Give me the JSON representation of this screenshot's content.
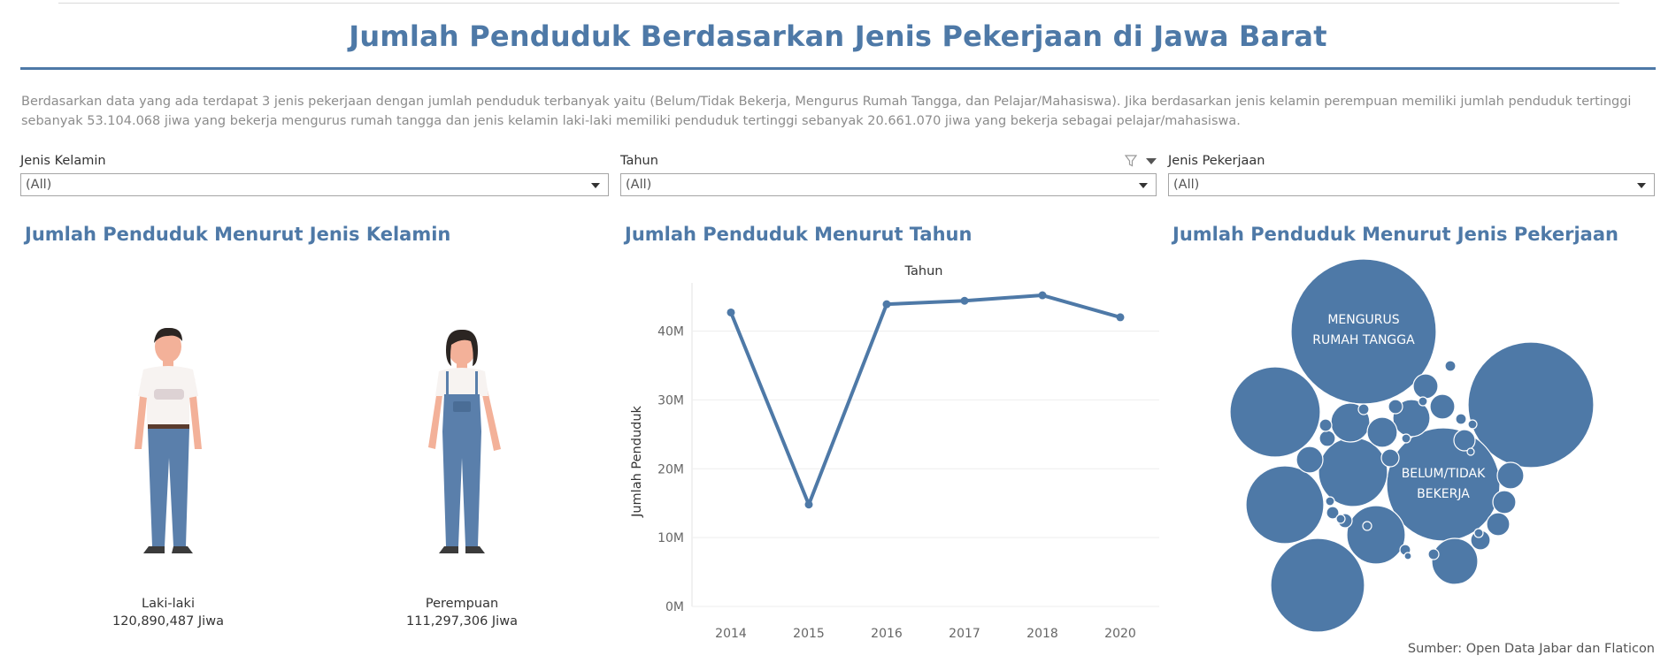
{
  "header": {
    "title": "Jumlah Penduduk Berdasarkan Jenis Pekerjaan di Jawa Barat",
    "description": "Berdasarkan data yang ada terdapat 3 jenis pekerjaan dengan jumlah penduduk terbanyak yaitu (Belum/Tidak Bekerja, Mengurus Rumah Tangga, dan Pelajar/Mahasiswa). Jika berdasarkan jenis kelamin perempuan memiliki jumlah penduduk tertinggi sebanyak 53.104.068 jiwa yang bekerja mengurus rumah tangga dan jenis kelamin laki-laki memiliki penduduk tertinggi sebanyak 20.661.070 jiwa yang bekerja sebagai pelajar/mahasiswa."
  },
  "filters": [
    {
      "label": "Jenis Kelamin",
      "value": "(All)"
    },
    {
      "label": "Tahun",
      "value": "(All)"
    },
    {
      "label": "Jenis Pekerjaan",
      "value": "(All)"
    }
  ],
  "gender_panel": {
    "title": "Jumlah Penduduk Menurut Jenis Kelamin",
    "male": {
      "label": "Laki-laki",
      "value": "120,890,487 Jiwa"
    },
    "female": {
      "label": "Perempuan",
      "value": "111,297,306 Jiwa"
    }
  },
  "year_panel": {
    "title": "Jumlah Penduduk Menurut Tahun"
  },
  "job_panel": {
    "title": "Jumlah Penduduk Menurut Jenis Pekerjaan"
  },
  "source": "Sumber: Open Data Jabar dan Flaticon",
  "colors": {
    "accent": "#4e79a7",
    "text_muted": "#8c8c8c"
  },
  "chart_data": [
    {
      "type": "line",
      "title": "Tahun",
      "xlabel": "",
      "ylabel": "Jumlah Penduduk",
      "categories": [
        "2014",
        "2015",
        "2016",
        "2017",
        "2018",
        "2020"
      ],
      "values": [
        42700000,
        14800000,
        43900000,
        44400000,
        45200000,
        42000000
      ],
      "y_ticks": [
        "0M",
        "10M",
        "20M",
        "30M",
        "40M"
      ],
      "ylim": [
        0,
        47000000
      ],
      "grid": true
    },
    {
      "type": "bubble",
      "labeled": [
        {
          "label_lines": [
            "MENGURUS",
            "RUMAH TANGGA"
          ]
        },
        {
          "label_lines": [
            "BELUM/TIDAK",
            "BEKERJA"
          ]
        }
      ]
    }
  ]
}
